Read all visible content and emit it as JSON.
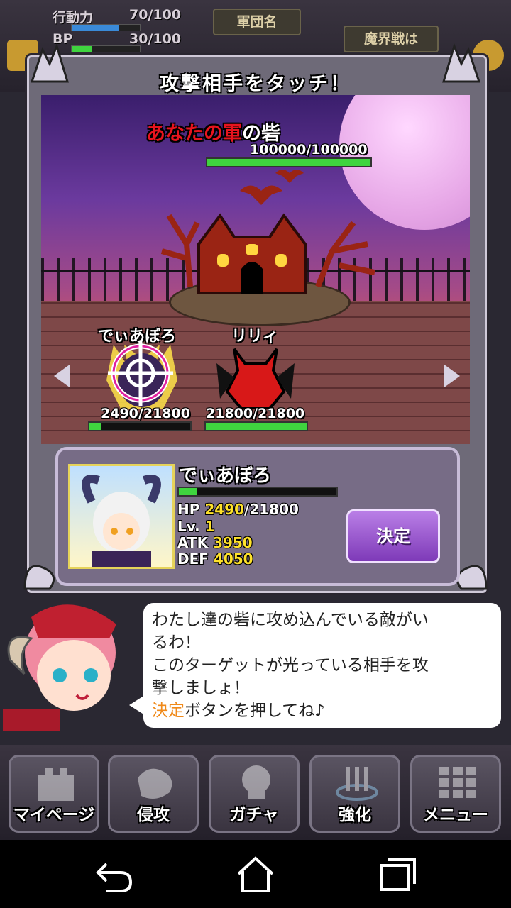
{
  "hud": {
    "action_label": "行動力",
    "action_value": "70/100",
    "action_fill": 0.7,
    "bp_label": "BP",
    "bp_value": "30/100",
    "bp_fill": 0.3,
    "legion_tab": "軍団名",
    "war_tab": "魔界戦は"
  },
  "dialog": {
    "title": "攻撃相手をタッチ！",
    "fort_name_red": "あなたの軍",
    "fort_name_white": "の砦",
    "fort_hp": "100000/100000",
    "fort_hp_fill": 1.0
  },
  "enemies": [
    {
      "name": "でぃあぼろ",
      "hp": "2490/21800",
      "hp_fill": 0.114,
      "targeted": true
    },
    {
      "name": "リリィ",
      "hp": "21800/21800",
      "hp_fill": 1.0,
      "targeted": false
    }
  ],
  "selected": {
    "name": "でぃあぼろ",
    "hp_label": "HP",
    "hp_current": "2490",
    "hp_max": "/21800",
    "hp_fill": 0.114,
    "lv_label": "Lv.",
    "lv": "1",
    "atk_label": "ATK",
    "atk": "3950",
    "def_label": "DEF",
    "def": "4050",
    "decide_label": "決定"
  },
  "speech": {
    "line1": "わたし達の砦に攻め込んでいる敵がい",
    "line2": "るわ！",
    "line3": "このターゲットが光っている相手を攻",
    "line4": "撃しましょ！",
    "line5_highlight": "決定",
    "line5_rest": "ボタンを押してね♪"
  },
  "nav": [
    {
      "label": "マイページ",
      "icon": "castle-icon"
    },
    {
      "label": "侵攻",
      "icon": "map-icon"
    },
    {
      "label": "ガチャ",
      "icon": "skull-icon"
    },
    {
      "label": "強化",
      "icon": "magic-circle-icon"
    },
    {
      "label": "メニュー",
      "icon": "grid-icon"
    }
  ],
  "system_bar": [
    "back-icon",
    "home-icon",
    "recent-apps-icon"
  ],
  "colors": {
    "accent_purple": "#8a3fc4",
    "hp_green": "#3fd43f",
    "highlight_yellow": "#ffe22a",
    "highlight_orange": "#f08a1a",
    "fort_red": "#e8141e"
  }
}
